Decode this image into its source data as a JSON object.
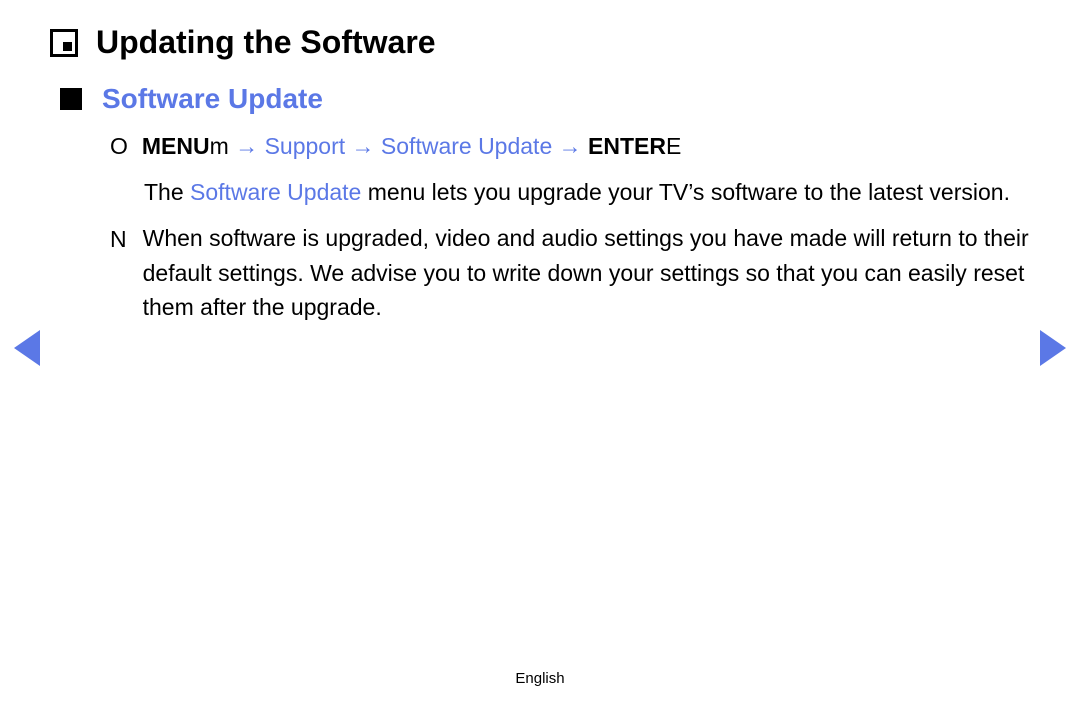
{
  "chapter": {
    "title": "Updating the Software"
  },
  "section": {
    "title": "Software Update"
  },
  "nav": {
    "bullet": "O",
    "menuLabel": "MENU",
    "menuSuffix": "m",
    "arrow1": " → ",
    "support": "Support",
    "arrow2": " → ",
    "softwareUpdate": "Software Update",
    "arrow3": " → ",
    "enterLabel": "ENTER",
    "enterSuffix": "E"
  },
  "description": {
    "prefix": "The ",
    "highlight": "Software Update",
    "suffix": " menu lets you upgrade your TV’s software to the latest version."
  },
  "note": {
    "bullet": "N",
    "text": "When software is upgraded, video and audio settings you have made will return to their default settings. We advise you to write down your settings so that you can easily reset them after the upgrade."
  },
  "footer": {
    "language": "English"
  }
}
